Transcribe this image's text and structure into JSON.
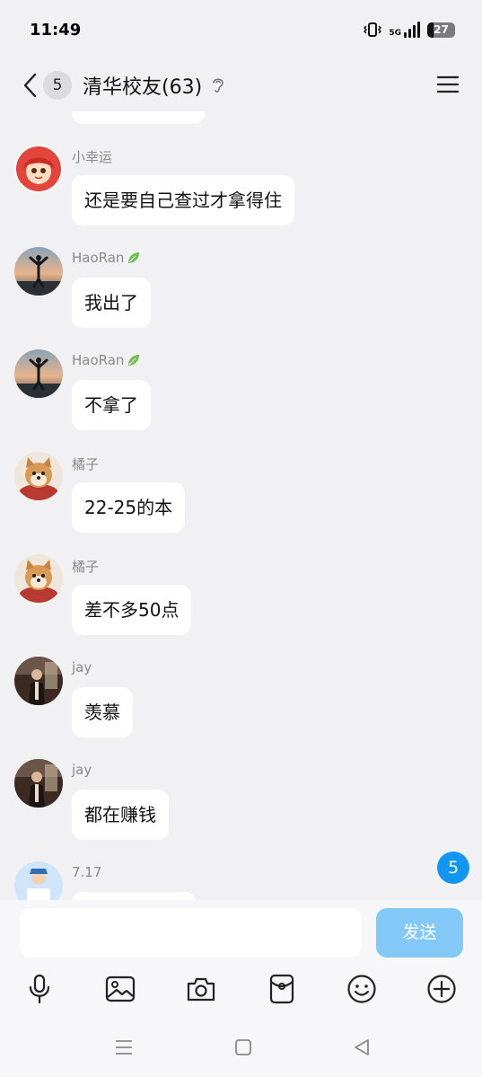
{
  "status_bar": {
    "time": "11:49",
    "network": "5G",
    "battery": "27"
  },
  "header": {
    "unread_count": "5",
    "title": "清华校友(63)"
  },
  "messages": [
    {
      "sender": "小幸运",
      "text": "还是要自己查过才拿得住",
      "badge": false
    },
    {
      "sender": "HaoRan",
      "text": "我出了",
      "badge": true
    },
    {
      "sender": "HaoRan",
      "text": "不拿了",
      "badge": true
    },
    {
      "sender": "橘子",
      "text": "22-25的本",
      "badge": false
    },
    {
      "sender": "橘子",
      "text": "差不多50点",
      "badge": false
    },
    {
      "sender": "jay",
      "text": "羡慕",
      "badge": false
    },
    {
      "sender": "jay",
      "text": "都在赚钱",
      "badge": false
    },
    {
      "sender": "7.17",
      "text": "",
      "badge": false
    }
  ],
  "new_messages_badge": "5",
  "composer": {
    "input_value": "",
    "send_label": "发送"
  },
  "toolbar_icons": [
    "microphone-icon",
    "image-icon",
    "camera-icon",
    "red-packet-icon",
    "emoji-icon",
    "plus-icon"
  ],
  "nav_icons": [
    "menu-icon",
    "home-icon",
    "back-icon"
  ],
  "colors": {
    "accent": "#1296f1",
    "send_disabled": "#82c9f7",
    "background": "#f1f1f3"
  }
}
